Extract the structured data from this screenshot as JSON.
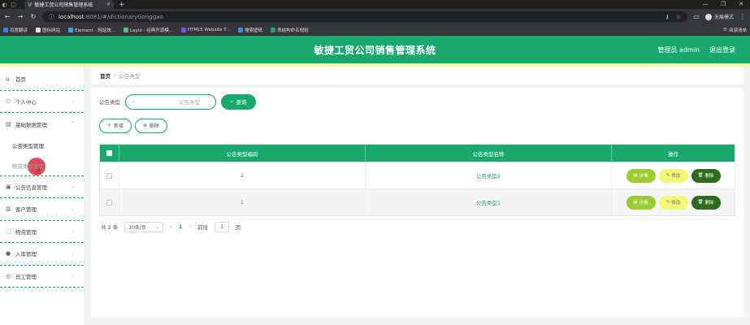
{
  "browser": {
    "tab_title": "敏捷工贸公司销售管理系统",
    "url_host": "localhost",
    "url_path": ":8081/#/dictionaryGonggao",
    "incognito_label": "无痕模式",
    "bookmarks": [
      {
        "label": "百度翻译",
        "color": "#3b7cf0"
      },
      {
        "label": "图标网站",
        "color": "#e0e0e0"
      },
      {
        "label": "Element - 网站快...",
        "color": "#409eff"
      },
      {
        "label": "Layui - 经典开源模...",
        "color": "#5fb878"
      },
      {
        "label": "HTML5 Website T...",
        "color": "#7b4ce0"
      },
      {
        "label": "搜索壁纸",
        "color": "#3c8cf0"
      },
      {
        "label": "表结构命名规则",
        "color": "#21a366"
      }
    ],
    "reading_list": "阅读清单"
  },
  "header": {
    "title": "敏捷工贸公司销售管理系统",
    "user": "管理员 admin",
    "logout": "退出登录"
  },
  "sidebar": {
    "items": [
      {
        "label": "首页",
        "icon": "home-icon",
        "glyph": "⌂",
        "arrow": ""
      },
      {
        "label": "个人中心",
        "icon": "user-icon",
        "glyph": "👤",
        "arrow": "⌄"
      },
      {
        "label": "基础数据管理",
        "icon": "data-icon",
        "glyph": "▤",
        "arrow": "⌃"
      }
    ],
    "subitems": [
      "公告类型管理",
      "物资类型管理"
    ],
    "items2": [
      {
        "label": "公告信息管理",
        "icon": "notice-icon",
        "glyph": "▣",
        "arrow": "⌄"
      },
      {
        "label": "客户管理",
        "icon": "customer-icon",
        "glyph": "▥",
        "arrow": "⌄"
      },
      {
        "label": "物资管理",
        "icon": "goods-icon",
        "glyph": "⬚",
        "arrow": "⌄"
      },
      {
        "label": "入库管理",
        "icon": "stock-icon",
        "glyph": "●",
        "arrow": "⌄"
      },
      {
        "label": "员工管理",
        "icon": "staff-icon",
        "glyph": "◎",
        "arrow": "⌄"
      }
    ]
  },
  "breadcrumb": {
    "home": "首页",
    "sep": "/",
    "current": "公告类型"
  },
  "search": {
    "label": "公告类型",
    "placeholder": "公告类型",
    "button": "查询"
  },
  "actions": {
    "add": "新增",
    "delete": "删除"
  },
  "table": {
    "columns": [
      "公告类型编码",
      "公告类型名称",
      "操作"
    ],
    "rows": [
      {
        "code": "2",
        "name": "公告类型2"
      },
      {
        "code": "1",
        "name": "公告类型1"
      }
    ],
    "ops": {
      "detail": "详情",
      "edit": "修改",
      "delete": "删除"
    }
  },
  "pager": {
    "total": "共 2 条",
    "page_size": "10条/页",
    "current_page": "1",
    "goto_label": "前往",
    "goto_value": "1",
    "page_suffix": "页"
  },
  "colors": {
    "primary": "#1aa86e",
    "detail": "#9acd32",
    "edit": "#f7f777",
    "delete": "#2e6b1e"
  }
}
